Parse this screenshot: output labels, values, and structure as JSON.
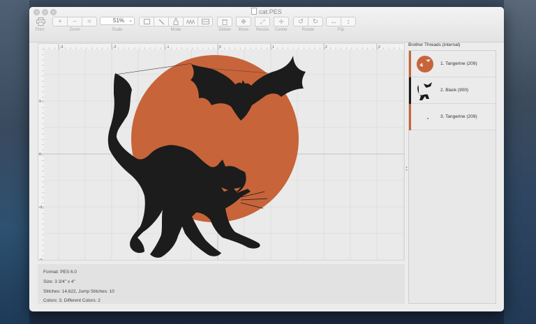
{
  "window": {
    "title": "cat.PES"
  },
  "toolbar": {
    "print_label": "Print",
    "zoom_label": "Zoom",
    "scale_label": "Scale",
    "scale_value": "51%",
    "mode_label": "Mode",
    "delete_label": "Delete",
    "move_label": "Move",
    "resize_label": "Resize",
    "center_label": "Center",
    "rotate_label": "Rotate",
    "flip_label": "Flip"
  },
  "ruler": {
    "x_ticks": [
      "-3",
      "-2",
      "-1",
      "0",
      "1",
      "2",
      "3"
    ],
    "y_ticks": [
      "1",
      "0",
      "-1",
      "-2"
    ]
  },
  "info": {
    "format": "Format: PES 6.0",
    "size": "Size: 3 3/4\" x 4\"",
    "stitches": "Stitches: 14,622, Jump Stitches: 10",
    "colors": "Colors: 3, Different Colors: 2"
  },
  "threads": {
    "title": "Brother Threads (internal)",
    "items": [
      {
        "label": "1. Tangerine (209)",
        "color": "#c8643a"
      },
      {
        "label": "2. Black (900)",
        "color": "#1a1a1a"
      },
      {
        "label": "3. Tangerine (209)",
        "color": "#c8643a"
      }
    ]
  },
  "colors": {
    "tangerine": "#c8643a",
    "black": "#1c1c1c"
  }
}
